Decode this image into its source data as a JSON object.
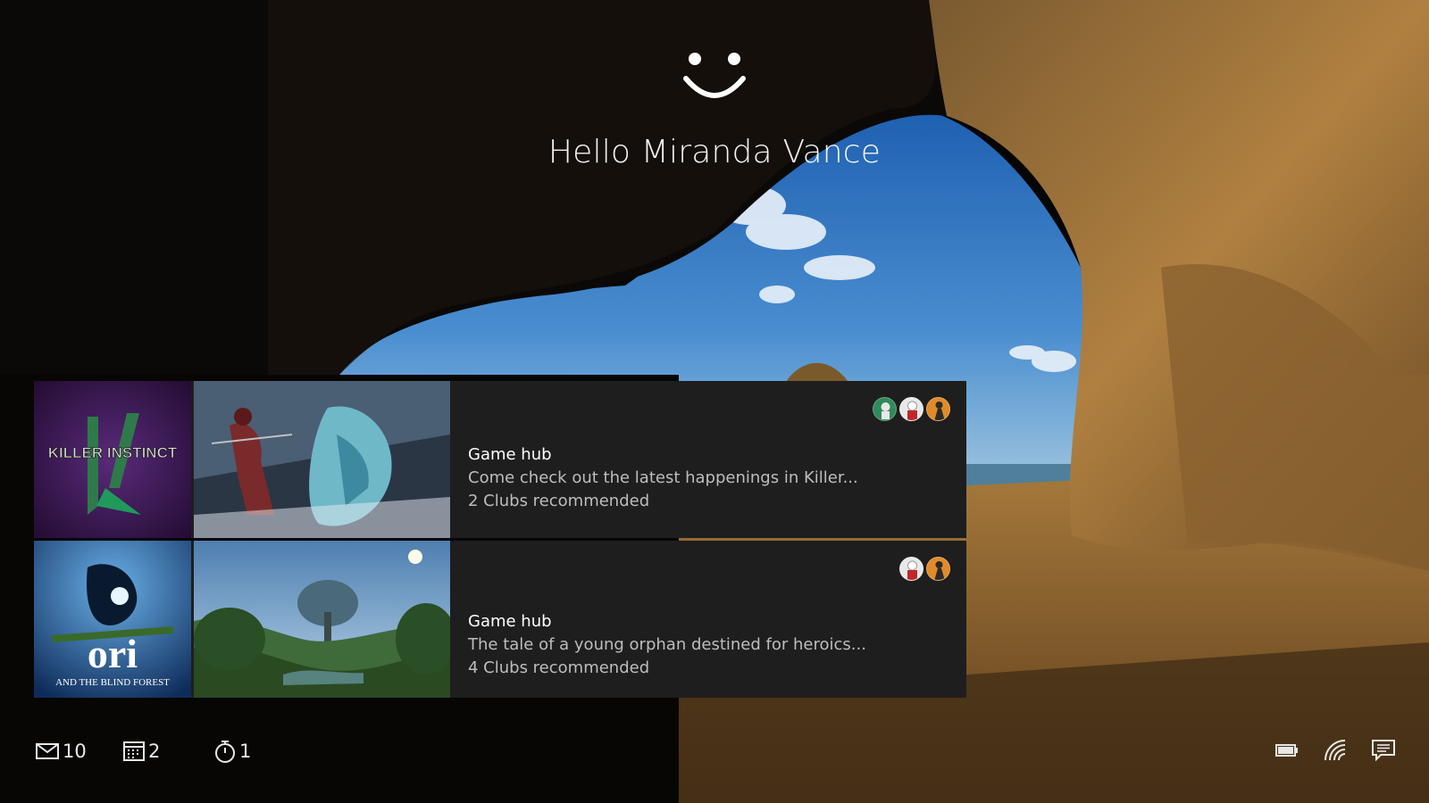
{
  "greeting": "Hello Miranda Vance",
  "cards": [
    {
      "title": "Game hub",
      "description": "Come check out the latest happenings in Killer...",
      "clubs": "2 Clubs recommended",
      "box_art_label": "KILLER INSTINCT",
      "avatar_count": 3
    },
    {
      "title": "Game hub",
      "description": "The tale of a young orphan destined for heroics...",
      "clubs": "4 Clubs recommended",
      "box_art_label": "ori",
      "box_art_sublabel": "AND THE BLIND FOREST",
      "avatar_count": 2
    }
  ],
  "status": {
    "mail_count": "10",
    "calendar_count": "2",
    "alarm_count": "1"
  },
  "icons": {
    "face": "smiley-face-icon",
    "mail": "mail-icon",
    "calendar": "calendar-icon",
    "alarm": "alarm-clock-icon",
    "battery": "battery-icon",
    "wifi": "wifi-icon",
    "notifications": "notifications-icon"
  }
}
